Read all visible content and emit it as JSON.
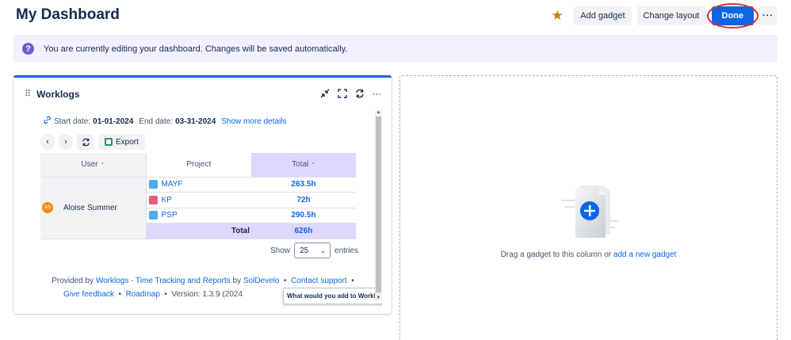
{
  "header": {
    "title": "My Dashboard",
    "add_gadget": "Add gadget",
    "change_layout": "Change layout",
    "done": "Done",
    "more": "···"
  },
  "banner": {
    "text": "You are currently editing your dashboard. Changes will be saved automatically."
  },
  "gadget": {
    "title": "Worklogs",
    "start_label": "Start date:",
    "start_date": "01-01-2024",
    "end_label": "End date:",
    "end_date": "03-31-2024",
    "show_more": "Show more details",
    "export": "Export",
    "columns": {
      "user": "User",
      "project": "Project",
      "total": "Total"
    },
    "user": {
      "initials": "AS",
      "name": "Aloise Summer"
    },
    "rows": [
      {
        "project": "MAYF",
        "total": "263.5h",
        "icon_color": "#4bade8"
      },
      {
        "project": "KP",
        "total": "72h",
        "icon_color": "#e05e7a"
      },
      {
        "project": "PSP",
        "total": "290.5h",
        "icon_color": "#4bade8"
      }
    ],
    "total_label": "Total",
    "grand_total": "626h",
    "show_label": "Show",
    "page_size": "25",
    "entries_label": "entries",
    "footer": {
      "provided_by": "Provided by",
      "app_link": "Worklogs - Time Tracking and Reports",
      "by": "by",
      "vendor": "SolDevelo",
      "contact": "Contact support",
      "feedback": "Give feedback",
      "roadmap": "Roadmap",
      "version": "Version: 1.3.9 (2024"
    },
    "tooltip": "What would you add to Worklogs?"
  },
  "drop_column": {
    "text": "Drag a gadget to this column or",
    "link": "add a new gadget"
  },
  "colors": {
    "primary": "#0c66e4",
    "accent_border": "#1868db",
    "total_bg": "#dfd8fd",
    "banner_bg": "#f3f0ff"
  }
}
